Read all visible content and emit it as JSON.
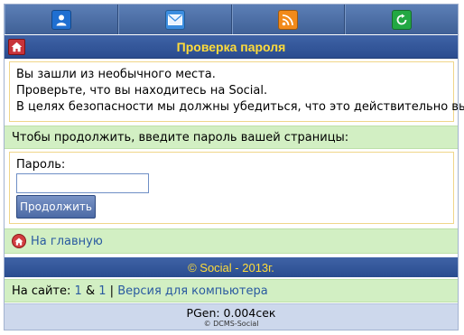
{
  "nav": {
    "items": [
      {
        "name": "user-icon",
        "color": "#1f6fd1"
      },
      {
        "name": "mail-icon",
        "color": "#3b8de0"
      },
      {
        "name": "rss-icon",
        "color": "#f28a1a"
      },
      {
        "name": "refresh-icon",
        "color": "#23a843"
      }
    ]
  },
  "header": {
    "title": "Проверка пароля"
  },
  "message": {
    "line1": "Вы зашли из необычного места.",
    "line2": "Проверьте, что вы находитесь на Social.",
    "line3": "В целях безопасности мы должны убедиться, что это действительно вы."
  },
  "prompt": "Чтобы продолжить, введите пароль вашей страницы:",
  "form": {
    "password_label": "Пароль:",
    "password_value": "",
    "submit_label": "Продолжить"
  },
  "home_link": "На главную",
  "copyright": "© Social - 2013г.",
  "online": {
    "label": "На сайте:",
    "count1": "1",
    "amp": "&",
    "count2": "1",
    "sep": "|",
    "desktop_link": "Версия для компьютера"
  },
  "footer": {
    "pgen": "PGen: 0.004сек",
    "cms": "© DCMS-Social"
  },
  "colors": {
    "header_bg": "#2f529a",
    "title_text": "#ffdc3a",
    "green_bar": "#d2efc3",
    "link": "#2a5aa0"
  }
}
